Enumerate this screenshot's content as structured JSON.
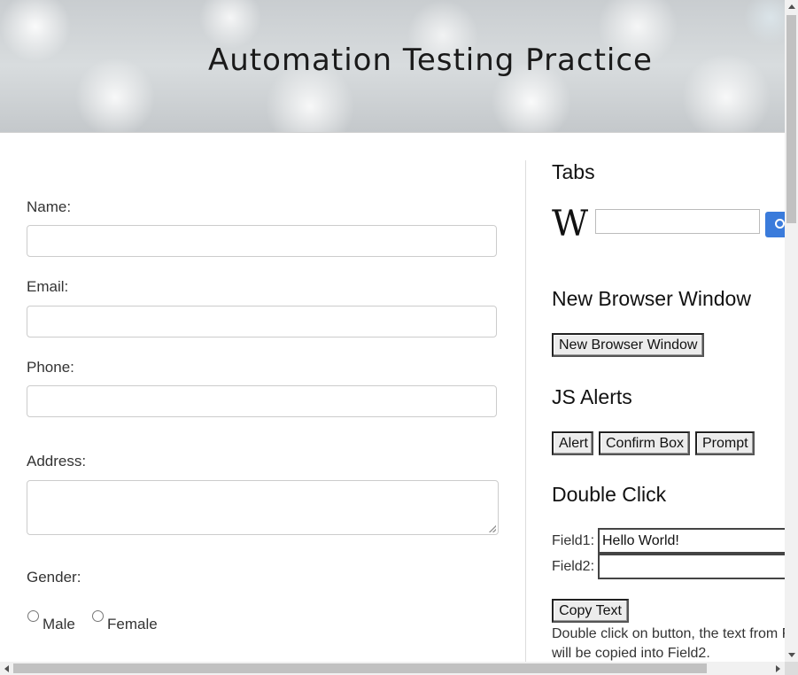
{
  "header": {
    "title": "Automation Testing Practice"
  },
  "form": {
    "name_label": "Name:",
    "email_label": "Email:",
    "phone_label": "Phone:",
    "address_label": "Address:",
    "gender_label": "Gender:",
    "gender_options": [
      "Male",
      "Female"
    ]
  },
  "tabs": {
    "title": "Tabs",
    "wiki_logo": "W",
    "search_placeholder": ""
  },
  "new_window": {
    "title": "New Browser Window",
    "button_label": "New Browser Window"
  },
  "alerts": {
    "title": "JS Alerts",
    "alert_label": "Alert",
    "confirm_label": "Confirm Box",
    "prompt_label": "Prompt"
  },
  "double_click": {
    "title": "Double Click",
    "field1_label": "Field1:",
    "field1_value": "Hello World!",
    "field2_label": "Field2:",
    "field2_value": "",
    "button_label": "Copy Text",
    "note_line1": "Double click on button, the text from F",
    "note_line2": "will be copied into Field2."
  },
  "colors": {
    "accent_blue": "#3a7bdb"
  }
}
